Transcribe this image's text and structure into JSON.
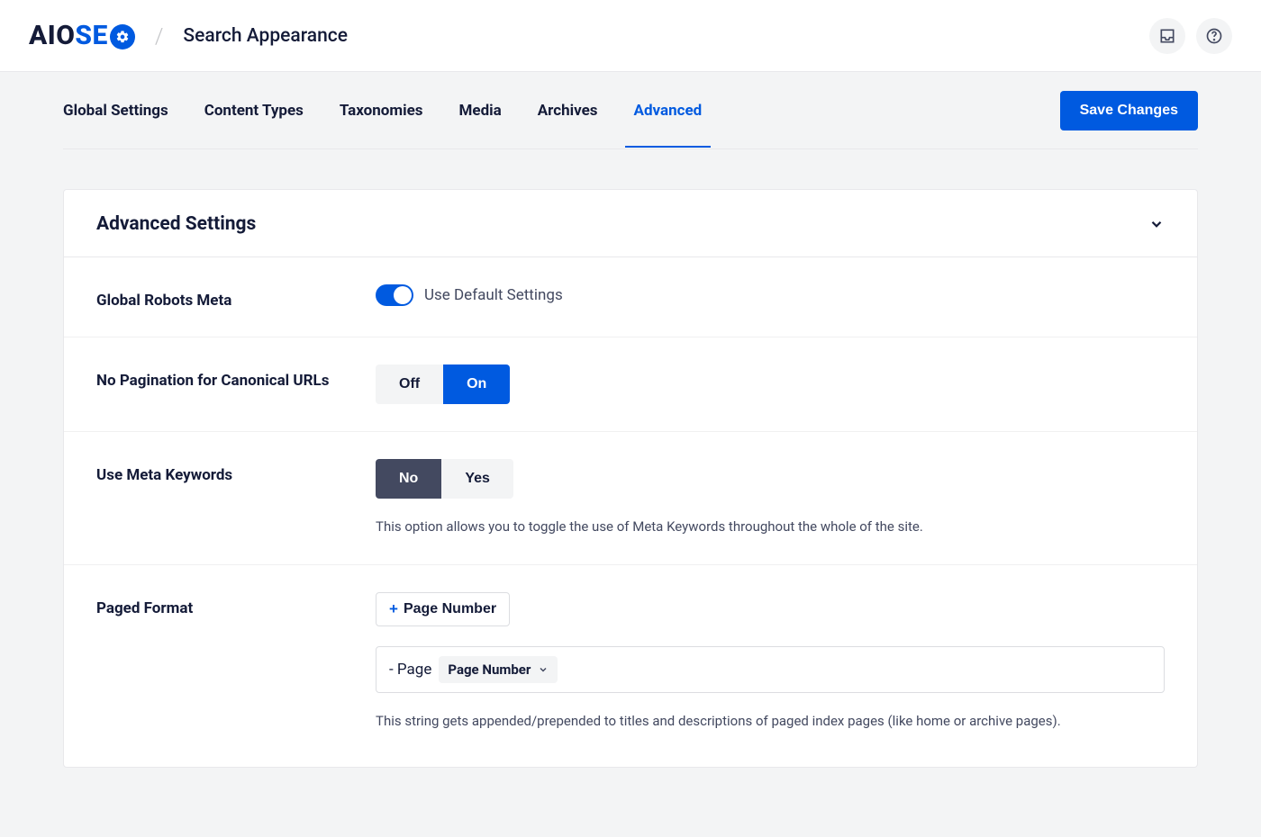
{
  "header": {
    "logo_prefix": "AIO",
    "logo_suffix": "SE",
    "page_title": "Search Appearance"
  },
  "tabs": {
    "items": [
      {
        "label": "Global Settings",
        "active": false
      },
      {
        "label": "Content Types",
        "active": false
      },
      {
        "label": "Taxonomies",
        "active": false
      },
      {
        "label": "Media",
        "active": false
      },
      {
        "label": "Archives",
        "active": false
      },
      {
        "label": "Advanced",
        "active": true
      }
    ],
    "save_label": "Save Changes"
  },
  "card": {
    "title": "Advanced Settings",
    "robots": {
      "label": "Global Robots Meta",
      "toggle_label": "Use Default Settings"
    },
    "canonical": {
      "label": "No Pagination for Canonical URLs",
      "off_label": "Off",
      "on_label": "On"
    },
    "meta_keywords": {
      "label": "Use Meta Keywords",
      "no_label": "No",
      "yes_label": "Yes",
      "desc": "This option allows you to toggle the use of Meta Keywords throughout the whole of the site."
    },
    "paged_format": {
      "label": "Paged Format",
      "tag_button": "Page Number",
      "input_prefix": "- Page",
      "chip_label": "Page Number",
      "desc": "This string gets appended/prepended to titles and descriptions of paged index pages (like home or archive pages)."
    }
  }
}
